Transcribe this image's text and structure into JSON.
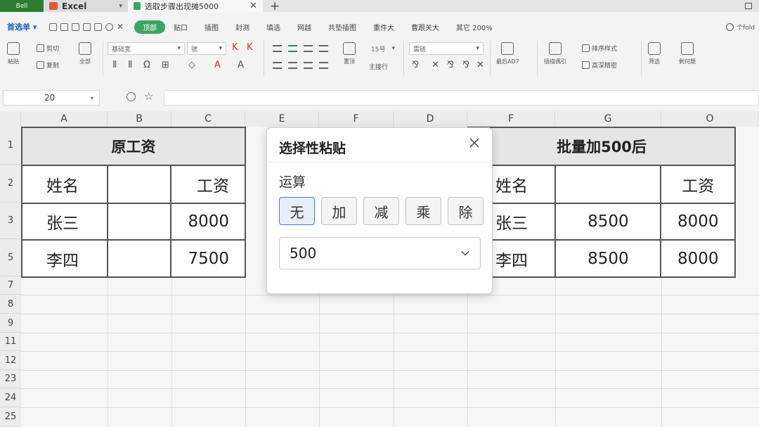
{
  "tabbar": {
    "app_label": "Bell",
    "excel_tab": "Excel",
    "doc_tab": "选取步骤出现摊5000"
  },
  "menu": {
    "main": "首选单",
    "items": [
      "顶部",
      "贴口",
      "插图",
      "封测",
      "填选",
      "网越",
      "共垫插图",
      "重件大",
      "曹跟关大",
      "其它 200%"
    ],
    "active_index": 0,
    "right_label": "个fold"
  },
  "ribbon": {
    "paste_label": "粘贴",
    "cut_label": "剪切",
    "copy_label": "复制",
    "format_painter_label": "全部",
    "font_name": "基础宽",
    "font_size": "號",
    "number_format": "15号",
    "style_box": "需链",
    "group_labels": [
      "置顶",
      "主接行",
      "最后AD7",
      "插描偶引",
      "排序样式",
      "高深精密",
      "筛选",
      "剩何题"
    ]
  },
  "formula_bar": {
    "name_box": "20"
  },
  "grid": {
    "columns": [
      "A",
      "B",
      "C",
      "E",
      "F",
      "D",
      "F",
      "G",
      "O"
    ],
    "rows": [
      "1",
      "2",
      "3",
      "5",
      "7",
      "8",
      "9",
      "11",
      "12",
      "23",
      "24",
      "25"
    ]
  },
  "left_table": {
    "title": "原工资",
    "header": {
      "name": "姓名",
      "salary": "工资"
    },
    "rows": [
      {
        "name": "张三",
        "salary": "8000"
      },
      {
        "name": "李四",
        "salary": "7500"
      }
    ]
  },
  "right_table": {
    "title": "批量加500后",
    "header": {
      "name": "姓名",
      "salary": "工资"
    },
    "rows": [
      {
        "name": "张三",
        "mid": "8500",
        "salary": "8000"
      },
      {
        "name": "李四",
        "mid": "8500",
        "salary": "8000"
      }
    ]
  },
  "dialog": {
    "title": "选择性粘贴",
    "section_label": "运算",
    "operations": [
      "无",
      "加",
      "减",
      "乘",
      "除"
    ],
    "selected_operation": "无",
    "value": "500",
    "accent_color": "#4a78c8"
  },
  "colors": {
    "brand_green": "#3aa564",
    "app_badge": "#2e7d32",
    "excel_logo": "#e0553b",
    "link_blue": "#1d5fbf"
  }
}
